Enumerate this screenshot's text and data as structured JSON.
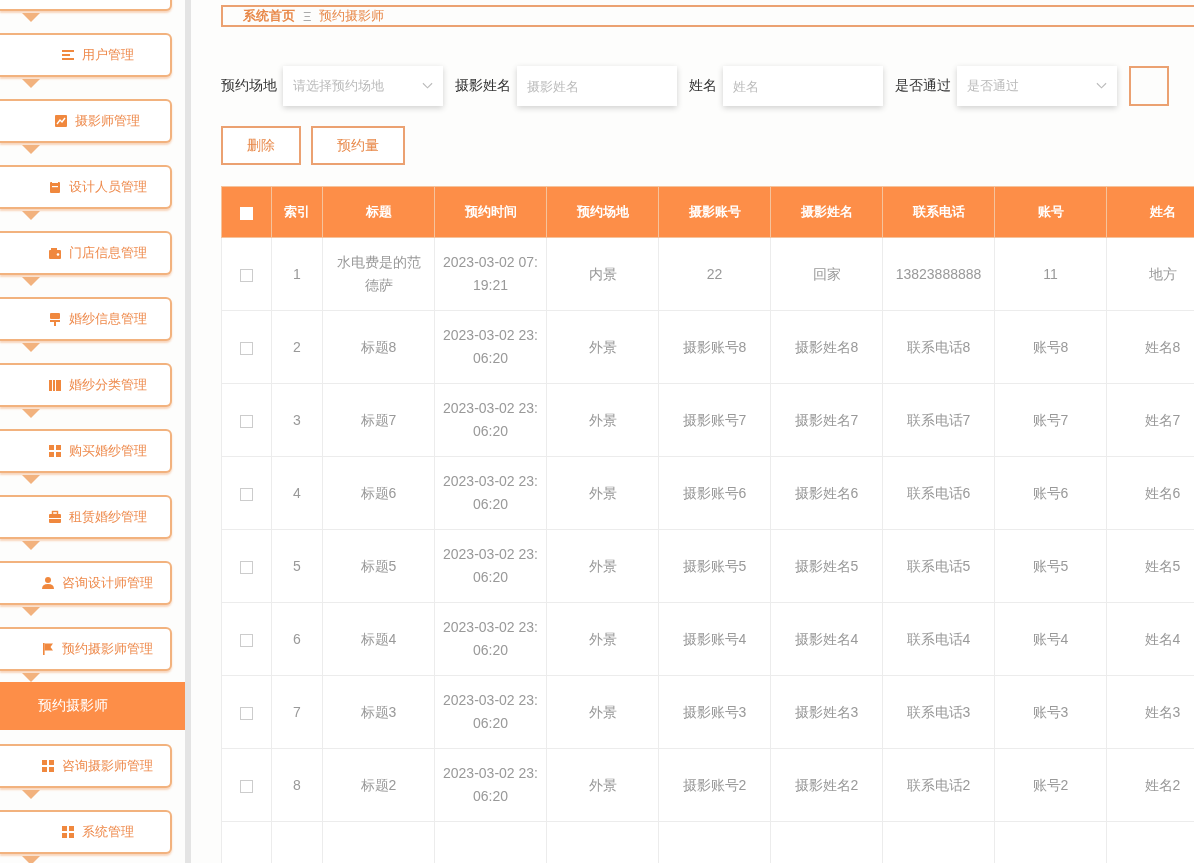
{
  "sidebar": {
    "items": [
      {
        "label": "用户管理",
        "selected": false
      },
      {
        "label": "摄影师管理",
        "selected": false
      },
      {
        "label": "设计人员管理",
        "selected": false
      },
      {
        "label": "门店信息管理",
        "selected": false
      },
      {
        "label": "婚纱信息管理",
        "selected": false
      },
      {
        "label": "婚纱分类管理",
        "selected": false
      },
      {
        "label": "购买婚纱管理",
        "selected": false
      },
      {
        "label": "租赁婚纱管理",
        "selected": false
      },
      {
        "label": "咨询设计师管理",
        "selected": false
      },
      {
        "label": "预约摄影师管理",
        "selected": false,
        "children": [
          {
            "label": "预约摄影师",
            "selected": true
          }
        ]
      },
      {
        "label": "咨询摄影师管理",
        "selected": false
      },
      {
        "label": "系统管理",
        "selected": false
      }
    ]
  },
  "breadcrumb": {
    "home": "系统首页",
    "separator": "Ξ",
    "current": "预约摄影师"
  },
  "filters": [
    {
      "kind": "select",
      "label": "预约场地",
      "placeholder": "请选择预约场地"
    },
    {
      "kind": "input",
      "label": "摄影姓名",
      "placeholder": "摄影姓名"
    },
    {
      "kind": "input",
      "label": "姓名",
      "placeholder": "姓名"
    },
    {
      "kind": "select",
      "label": "是否通过",
      "placeholder": "是否通过"
    }
  ],
  "buttons": [
    "删除",
    "预约量"
  ],
  "table": {
    "header_checked": false,
    "columns": [
      "索引",
      "标题",
      "预约时间",
      "预约场地",
      "摄影账号",
      "摄影姓名",
      "联系电话",
      "账号",
      "姓名"
    ],
    "rows": [
      {
        "checked": false,
        "cells": [
          "1",
          "水电费是的范德萨",
          "2023-03-02 07:19:21",
          "内景",
          "22",
          "回家",
          "13823888888",
          "11",
          "地方"
        ]
      },
      {
        "checked": false,
        "cells": [
          "2",
          "标题8",
          "2023-03-02 23:06:20",
          "外景",
          "摄影账号8",
          "摄影姓名8",
          "联系电话8",
          "账号8",
          "姓名8"
        ]
      },
      {
        "checked": false,
        "cells": [
          "3",
          "标题7",
          "2023-03-02 23:06:20",
          "外景",
          "摄影账号7",
          "摄影姓名7",
          "联系电话7",
          "账号7",
          "姓名7"
        ]
      },
      {
        "checked": false,
        "cells": [
          "4",
          "标题6",
          "2023-03-02 23:06:20",
          "外景",
          "摄影账号6",
          "摄影姓名6",
          "联系电话6",
          "账号6",
          "姓名6"
        ]
      },
      {
        "checked": false,
        "cells": [
          "5",
          "标题5",
          "2023-03-02 23:06:20",
          "外景",
          "摄影账号5",
          "摄影姓名5",
          "联系电话5",
          "账号5",
          "姓名5"
        ]
      },
      {
        "checked": false,
        "cells": [
          "6",
          "标题4",
          "2023-03-02 23:06:20",
          "外景",
          "摄影账号4",
          "摄影姓名4",
          "联系电话4",
          "账号4",
          "姓名4"
        ]
      },
      {
        "checked": false,
        "cells": [
          "7",
          "标题3",
          "2023-03-02 23:06:20",
          "外景",
          "摄影账号3",
          "摄影姓名3",
          "联系电话3",
          "账号3",
          "姓名3"
        ]
      },
      {
        "checked": false,
        "cells": [
          "8",
          "标题2",
          "2023-03-02 23:06:20",
          "外景",
          "摄影账号2",
          "摄影姓名2",
          "联系电话2",
          "账号2",
          "姓名2"
        ]
      }
    ]
  }
}
